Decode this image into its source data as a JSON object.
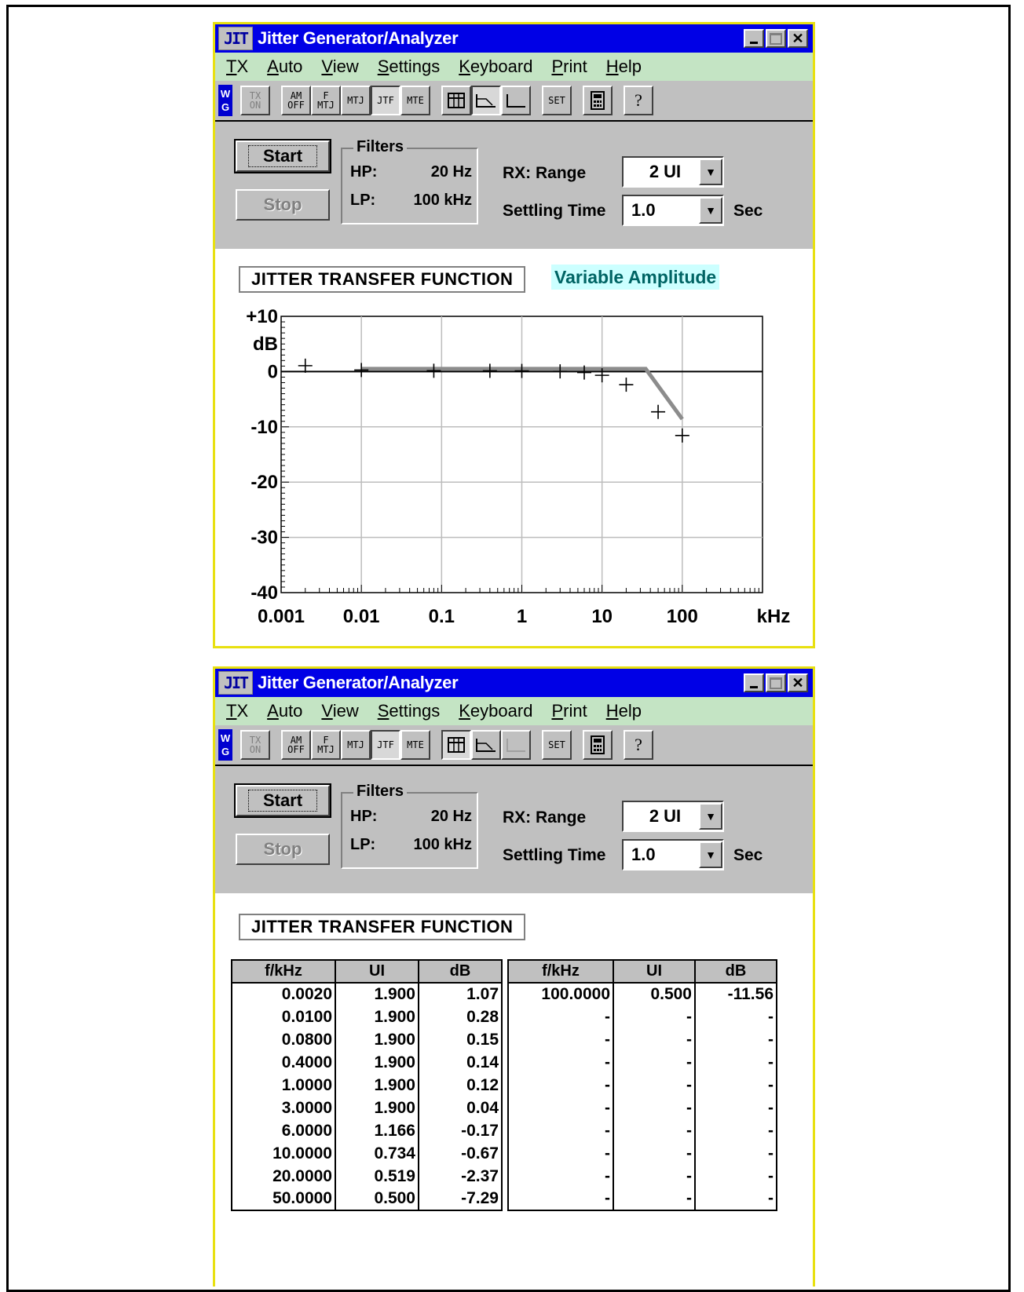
{
  "window": {
    "app_icon": "JIT",
    "title": "Jitter Generator/Analyzer",
    "controls": [
      "minimize-icon",
      "maximize-icon",
      "close-icon"
    ]
  },
  "menu": [
    {
      "label": "TX",
      "u": "T",
      "rest": "X"
    },
    {
      "label": "Auto",
      "u": "A",
      "rest": "uto"
    },
    {
      "label": "View",
      "u": "V",
      "rest": "iew"
    },
    {
      "label": "Settings",
      "u": "S",
      "rest": "ettings"
    },
    {
      "label": "Keyboard",
      "u": "K",
      "rest": "eyboard"
    },
    {
      "label": "Print",
      "u": "P",
      "rest": "rint"
    },
    {
      "label": "Help",
      "u": "H",
      "rest": "elp"
    }
  ],
  "toolbar": {
    "badge_top": "W",
    "badge_bottom": "G",
    "tx_on": "TX\nON",
    "am_off": "AM\nOFF",
    "f_mtj": "F\nMTJ",
    "mtj": "MTJ",
    "jtf": "JTF",
    "mte": "MTE",
    "set": "SET",
    "help": "?"
  },
  "controls": {
    "start_label": "Start",
    "stop_label": "Stop",
    "filters_title": "Filters",
    "hp_label": "HP:",
    "hp_value": "20 Hz",
    "lp_label": "LP:",
    "lp_value": "100 kHz",
    "rx_range_label": "RX: Range",
    "rx_range_value": "2 UI",
    "settling_label": "Settling Time",
    "settling_value": "1.0",
    "settling_unit": "Sec"
  },
  "graph_view": {
    "title": "JITTER TRANSFER FUNCTION",
    "mode_label": "Variable Amplitude",
    "chart_data": {
      "type": "scatter",
      "x_scale": "log",
      "xlim": [
        0.001,
        1000
      ],
      "ylim": [
        -40,
        10
      ],
      "x_ticks": [
        "0.001",
        "0.01",
        "0.1",
        "1",
        "10",
        "100"
      ],
      "x_unit": "kHz",
      "y_ticks": [
        "+10",
        "0",
        "-10",
        "-20",
        "-30",
        "-40"
      ],
      "y_unit": "dB",
      "grid": true,
      "mask_line": [
        [
          0.01,
          0.5
        ],
        [
          35,
          0.5
        ],
        [
          100,
          -8.6
        ]
      ],
      "measured": [
        [
          0.002,
          1.07
        ],
        [
          0.01,
          0.28
        ],
        [
          0.08,
          0.15
        ],
        [
          0.4,
          0.14
        ],
        [
          1,
          0.12
        ],
        [
          3,
          0.04
        ],
        [
          6,
          -0.17
        ],
        [
          10,
          -0.67
        ],
        [
          20,
          -2.37
        ],
        [
          50,
          -7.29
        ],
        [
          100,
          -11.56
        ]
      ]
    }
  },
  "table_view": {
    "title": "JITTER TRANSFER FUNCTION",
    "columns": [
      "f/kHz",
      "UI",
      "dB"
    ],
    "left_rows": [
      [
        "0.0020",
        "1.900",
        "1.07"
      ],
      [
        "0.0100",
        "1.900",
        "0.28"
      ],
      [
        "0.0800",
        "1.900",
        "0.15"
      ],
      [
        "0.4000",
        "1.900",
        "0.14"
      ],
      [
        "1.0000",
        "1.900",
        "0.12"
      ],
      [
        "3.0000",
        "1.900",
        "0.04"
      ],
      [
        "6.0000",
        "1.166",
        "-0.17"
      ],
      [
        "10.0000",
        "0.734",
        "-0.67"
      ],
      [
        "20.0000",
        "0.519",
        "-2.37"
      ],
      [
        "50.0000",
        "0.500",
        "-7.29"
      ]
    ],
    "right_rows": [
      [
        "100.0000",
        "0.500",
        "-11.56"
      ],
      [
        "-",
        "-",
        "-"
      ],
      [
        "-",
        "-",
        "-"
      ],
      [
        "-",
        "-",
        "-"
      ],
      [
        "-",
        "-",
        "-"
      ],
      [
        "-",
        "-",
        "-"
      ],
      [
        "-",
        "-",
        "-"
      ],
      [
        "-",
        "-",
        "-"
      ],
      [
        "-",
        "-",
        "-"
      ],
      [
        "-",
        "-",
        "-"
      ]
    ]
  }
}
